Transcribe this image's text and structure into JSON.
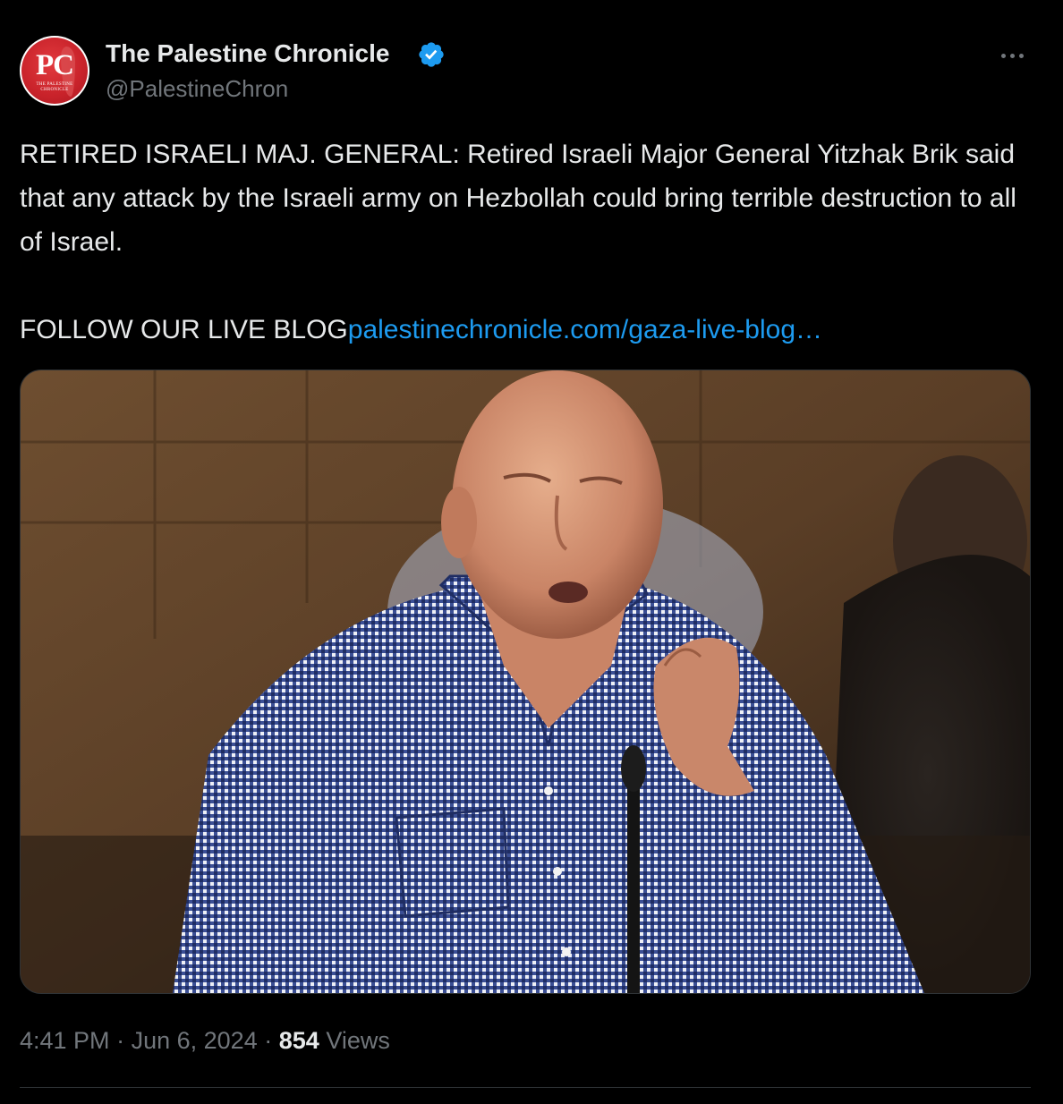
{
  "account": {
    "display_name": "The Palestine Chronicle",
    "handle": "@PalestineChron",
    "verified_icon": "verified-badge-icon",
    "avatar_initials": "PC",
    "avatar_subtext_line1": "THE PALESTINE",
    "avatar_subtext_line2": "CHRONICLE"
  },
  "tweet": {
    "text_line1": "RETIRED ISRAELI MAJ. GENERAL: Retired Israeli Major General Yitzhak Brik said that any attack by the Israeli army on Hezbollah could bring terrible destruction to all of Israel.",
    "follow_text": "FOLLOW OUR LIVE BLOG",
    "link_text": "palestinechronicle.com/gaza-live-blog…"
  },
  "footer": {
    "time": "4:41 PM",
    "separator": "·",
    "date": "Jun 6, 2024",
    "views_count": "854",
    "views_label": "Views"
  },
  "colors": {
    "background": "#000000",
    "text": "#e7e9ea",
    "secondary": "#71767b",
    "link": "#1d9bf0",
    "verified": "#1d9bf0",
    "border": "#2f3336",
    "avatar_red": "#c8222a"
  }
}
